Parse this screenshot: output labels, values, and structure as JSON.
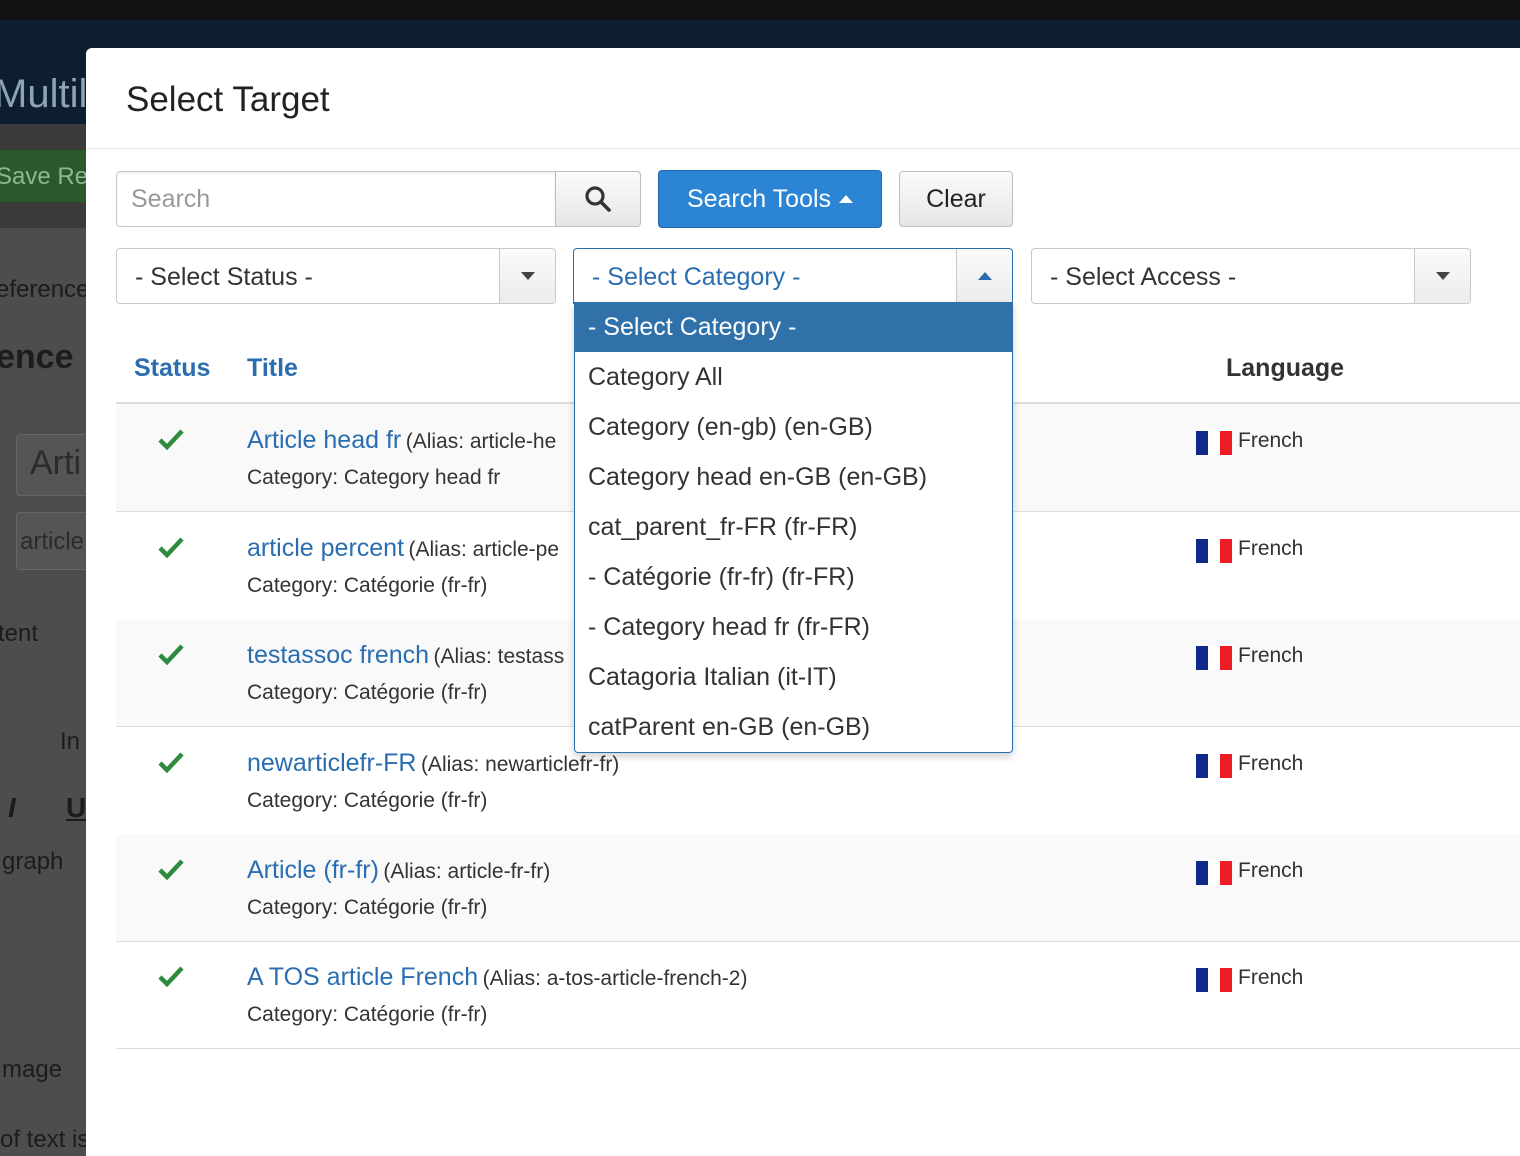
{
  "background": {
    "header_title": "Multil",
    "save_label": "Save Re",
    "reference_tab": "eference",
    "section_title": "ence",
    "title_field": "Arti",
    "alias_field": "article",
    "content_tab": "tent",
    "toolbar_insert": "In",
    "italic": "I",
    "underline": "U",
    "paragraph": "graph",
    "image_label": "mage",
    "bottom_text": "of text is"
  },
  "modal": {
    "title": "Select Target"
  },
  "search": {
    "placeholder": "Search",
    "tools_label": "Search Tools",
    "clear_label": "Clear"
  },
  "filters": {
    "status": "- Select Status -",
    "category": "- Select Category -",
    "access": "- Select Access -"
  },
  "category_options": [
    "- Select Category -",
    "Category All",
    "Category (en-gb) (en-GB)",
    "Category head en-GB (en-GB)",
    "cat_parent_fr-FR (fr-FR)",
    "- Catégorie (fr-fr) (fr-FR)",
    "- Category head fr (fr-FR)",
    "Catagoria Italian (it-IT)",
    "catParent en-GB (en-GB)"
  ],
  "table": {
    "headers": {
      "status": "Status",
      "title": "Title",
      "language": "Language"
    },
    "rows": [
      {
        "title": "Article head fr",
        "alias": "(Alias: article-he",
        "category": "Category: Category head fr",
        "language": "French"
      },
      {
        "title": "article percent",
        "alias": "(Alias: article-pe",
        "category": "Category: Catégorie (fr-fr)",
        "language": "French"
      },
      {
        "title": "testassoc french",
        "alias": "(Alias: testass",
        "category": "Category: Catégorie (fr-fr)",
        "language": "French"
      },
      {
        "title": "newarticlefr-FR",
        "alias": "(Alias: newarticlefr-fr)",
        "category": "Category: Catégorie (fr-fr)",
        "language": "French"
      },
      {
        "title": "Article (fr-fr)",
        "alias": "(Alias: article-fr-fr)",
        "category": "Category: Catégorie (fr-fr)",
        "language": "French"
      },
      {
        "title": "A TOS article French",
        "alias": "(Alias: a-tos-article-french-2)",
        "category": "Category: Catégorie (fr-fr)",
        "language": "French"
      }
    ]
  },
  "colors": {
    "link": "#2a6db0",
    "primary_button": "#2b84d4",
    "selected_option": "#3071a9",
    "check": "#2e8b3e"
  },
  "icons": {
    "search": "search-icon",
    "status": "check-icon",
    "flag": "french-flag-icon"
  }
}
